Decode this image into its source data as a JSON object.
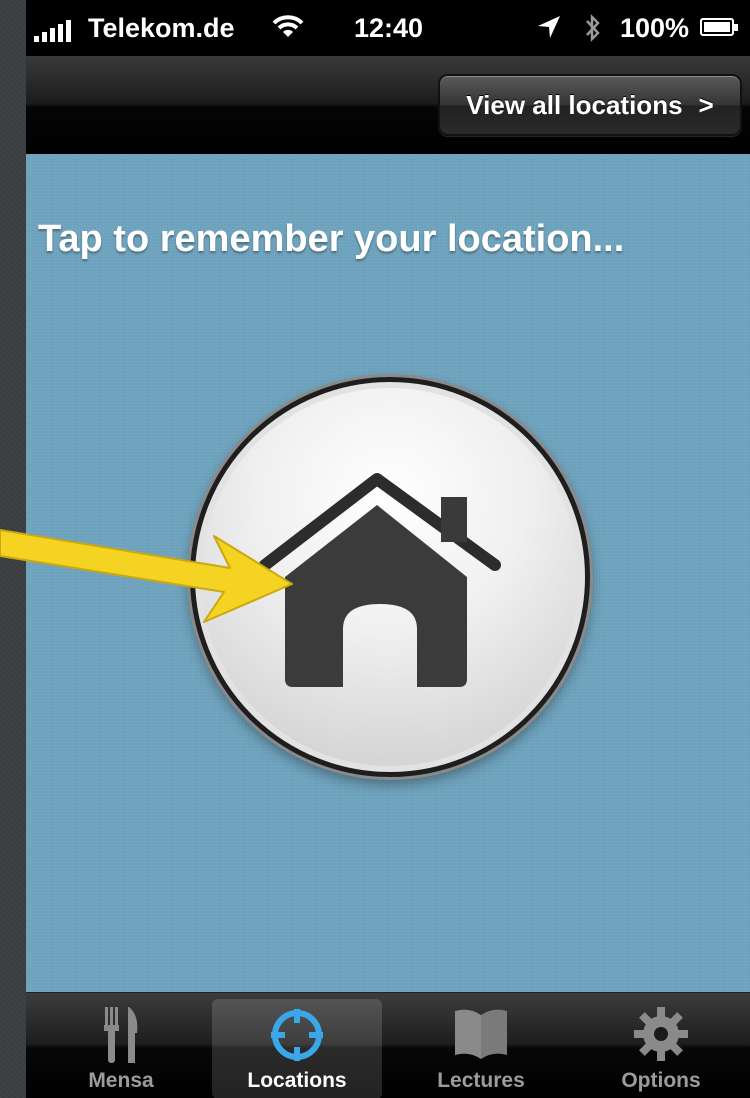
{
  "status_bar": {
    "carrier": "Telekom.de",
    "time": "12:40",
    "battery": "100%",
    "icons": [
      "signal-icon",
      "wifi-icon",
      "location-arrow-icon",
      "bluetooth-icon",
      "battery-charging-icon"
    ]
  },
  "nav": {
    "right_button_label": "View all locations",
    "right_button_chevron": ">"
  },
  "main": {
    "headline": "Tap to remember your location...",
    "home_button_icon": "home-icon",
    "annotation": "yellow-arrow-pointing-to-home-button"
  },
  "tabs": [
    {
      "label": "Mensa",
      "icon": "fork-knife-icon",
      "active": false
    },
    {
      "label": "Locations",
      "icon": "crosshair-icon",
      "active": true
    },
    {
      "label": "Lectures",
      "icon": "book-icon",
      "active": false
    },
    {
      "label": "Options",
      "icon": "gear-icon",
      "active": false
    }
  ],
  "colors": {
    "content_background": "#6fa4bf",
    "accent_active_tab": "#3aa8e8",
    "annotation_arrow": "#f5d323"
  }
}
